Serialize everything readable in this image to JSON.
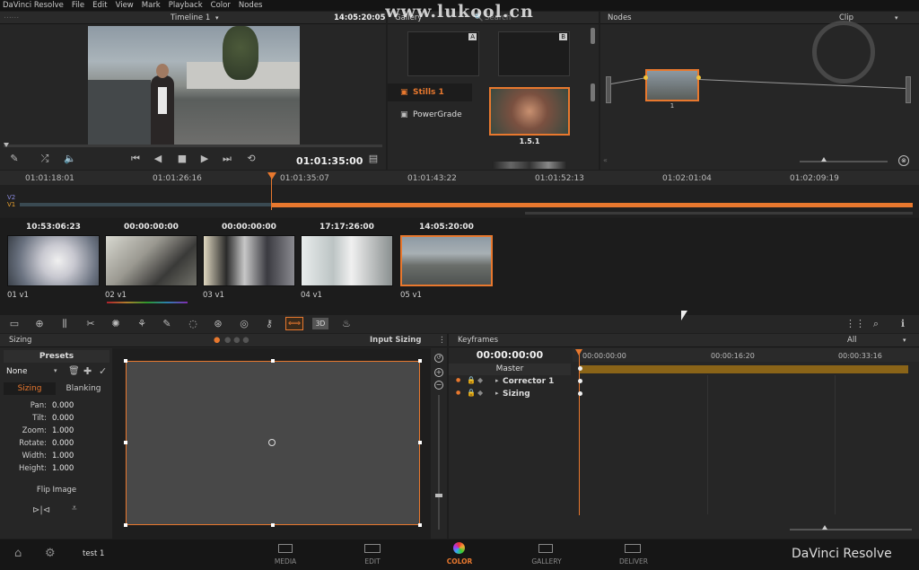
{
  "menu": [
    "DaVinci Resolve",
    "File",
    "Edit",
    "View",
    "Mark",
    "Playback",
    "Color",
    "Nodes"
  ],
  "viewer": {
    "title": "Timeline 1",
    "timecode_top": "14:05:20:05",
    "timecode": "01:01:35:00"
  },
  "gallery": {
    "title": "Gallery",
    "search_placeholder": "Search",
    "slot_a": "A",
    "slot_b": "B",
    "albums": [
      "Stills 1",
      "PowerGrade"
    ],
    "still_label": "1.5.1"
  },
  "nodes": {
    "title": "Nodes",
    "mode": "Clip",
    "node_label": "1"
  },
  "watermark": "www.lukool.cn",
  "timeline": {
    "ruler": [
      "01:01:18:01",
      "01:01:26:16",
      "01:01:35:07",
      "01:01:43:22",
      "01:01:52:13",
      "01:02:01:04",
      "01:02:09:19"
    ],
    "tracks": [
      "V2",
      "V1"
    ]
  },
  "clips": [
    {
      "tc": "10:53:06:23",
      "label": "01  v1"
    },
    {
      "tc": "00:00:00:00",
      "label": "02  v1"
    },
    {
      "tc": "00:00:00:00",
      "label": "03  v1"
    },
    {
      "tc": "17:17:26:00",
      "label": "04  v1"
    },
    {
      "tc": "14:05:20:00",
      "label": "05  v1"
    }
  ],
  "sizing": {
    "title": "Sizing",
    "mode": "Input Sizing",
    "presets": "Presets",
    "preset_value": "None",
    "tab_sizing": "Sizing",
    "tab_blanking": "Blanking",
    "params": [
      {
        "k": "Pan:",
        "v": "0.000"
      },
      {
        "k": "Tilt:",
        "v": "0.000"
      },
      {
        "k": "Zoom:",
        "v": "1.000"
      },
      {
        "k": "Rotate:",
        "v": "0.000"
      },
      {
        "k": "Width:",
        "v": "1.000"
      },
      {
        "k": "Height:",
        "v": "1.000"
      }
    ],
    "flip": "Flip Image"
  },
  "keyframes": {
    "title": "Keyframes",
    "filter": "All",
    "timecode": "00:00:00:00",
    "ruler": [
      "00:00:00:00",
      "00:00:16:20",
      "00:00:33:16"
    ],
    "rows": [
      "Master",
      "Corrector 1",
      "Sizing"
    ]
  },
  "bottom": {
    "project": "test 1",
    "pages": [
      "MEDIA",
      "EDIT",
      "COLOR",
      "GALLERY",
      "DELIVER"
    ],
    "brand": "DaVinci Resolve",
    "active_page": "COLOR"
  },
  "colors": {
    "accent": "#e8782e",
    "bg": "#1e1e1e"
  }
}
